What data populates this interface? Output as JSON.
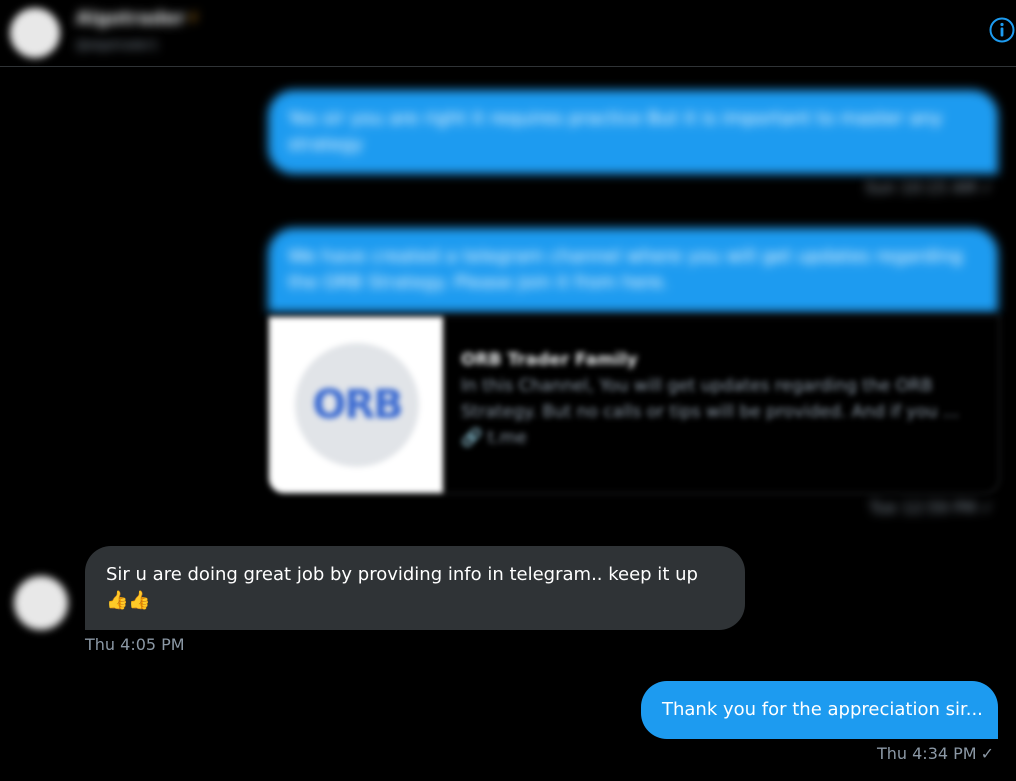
{
  "header": {
    "name": "Algotrader",
    "bolt_icon": "lightning-icon",
    "handle": "@algotrader1",
    "info_icon": "info-icon"
  },
  "messages": [
    {
      "direction": "out",
      "text": "Yes sir you are right it requires practice But it is important to master any strategy",
      "time": "Sun 10:15 AM",
      "check": "✓"
    },
    {
      "direction": "out",
      "text": "We have created a telegram channel where you will get updates regarding the ORB Strategy. Please Join it from here.",
      "card": {
        "thumb_text": "ORB",
        "title": "ORB Trader Family",
        "description": "In this Channel, You will get updates regarding the ORB Strategy. But no calls or tips will be provided. And if you ...",
        "link_label": "🔗 t.me"
      },
      "time": "Tue 12:59 PM",
      "check": "✓"
    },
    {
      "direction": "in",
      "text": "Sir u are doing great job by providing info in telegram.. keep it up 👍👍",
      "time": "Thu 4:05 PM"
    },
    {
      "direction": "out",
      "text": "Thank you for the appreciation sir...",
      "time": "Thu 4:34 PM",
      "check": "✓"
    }
  ],
  "colors": {
    "background": "#000000",
    "outgoing_bubble": "#1d9bf0",
    "incoming_bubble": "#2f3336",
    "meta_text": "#8b98a5"
  }
}
